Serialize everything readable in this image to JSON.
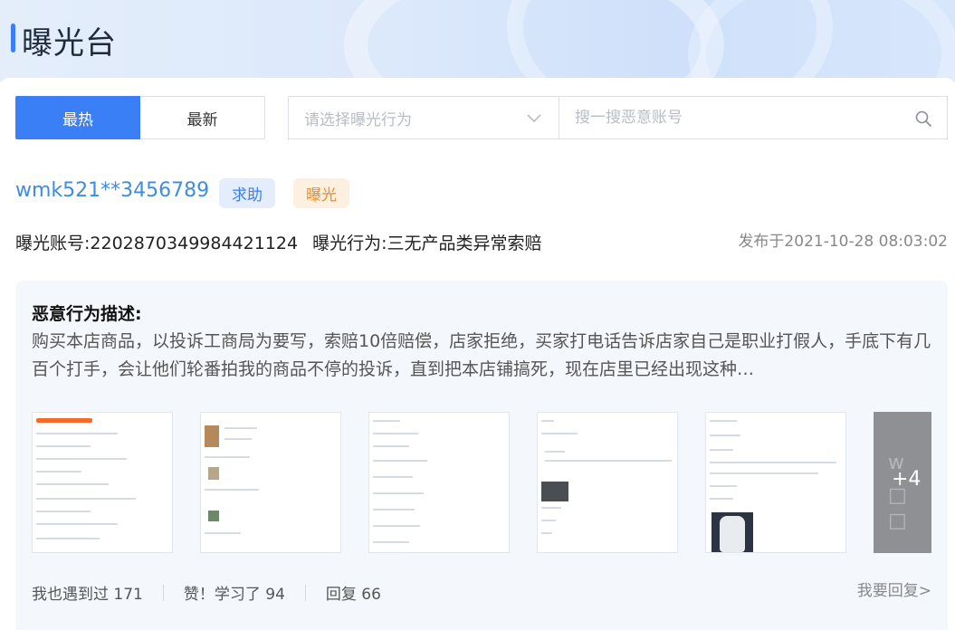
{
  "page": {
    "title": "曝光台"
  },
  "tabs": [
    {
      "label": "最热",
      "active": true
    },
    {
      "label": "最新",
      "active": false
    }
  ],
  "filter": {
    "placeholder": "请选择曝光行为"
  },
  "search": {
    "placeholder": "搜一搜恶意账号"
  },
  "post": {
    "account": "wmk521**3456789",
    "badges": {
      "help": "求助",
      "expose": "曝光"
    },
    "account_no_label": "曝光账号:",
    "account_no": "2202870349984421124",
    "behavior_label": "曝光行为:",
    "behavior": "三无产品类异常索赔",
    "published": "发布于2021-10-28 08:03:02",
    "description_title": "恶意行为描述:",
    "description": "购买本店商品，以投诉工商局为要写，索赔10倍赔偿，店家拒绝，买家打电话告诉店家自己是职业打假人，手底下有几百个打手，会让他们轮番拍我的商品不停的投诉，直到把本店铺搞死，现在店里已经出现这种…",
    "more_images": "+4",
    "actions": {
      "met": "我也遇到过 171",
      "like": "赞！学习了 94",
      "replies": "回复 66"
    },
    "reply_link": "我要回复>"
  },
  "colors": {
    "primary": "#3a7ff5",
    "link": "#3d8de0",
    "help_badge_bg": "#e3edfb",
    "expose_badge_bg": "#fdf0e0",
    "expose_badge_text": "#f08c25"
  },
  "icons": {
    "select_arrow": "chevron-down-icon",
    "search": "search-icon"
  }
}
